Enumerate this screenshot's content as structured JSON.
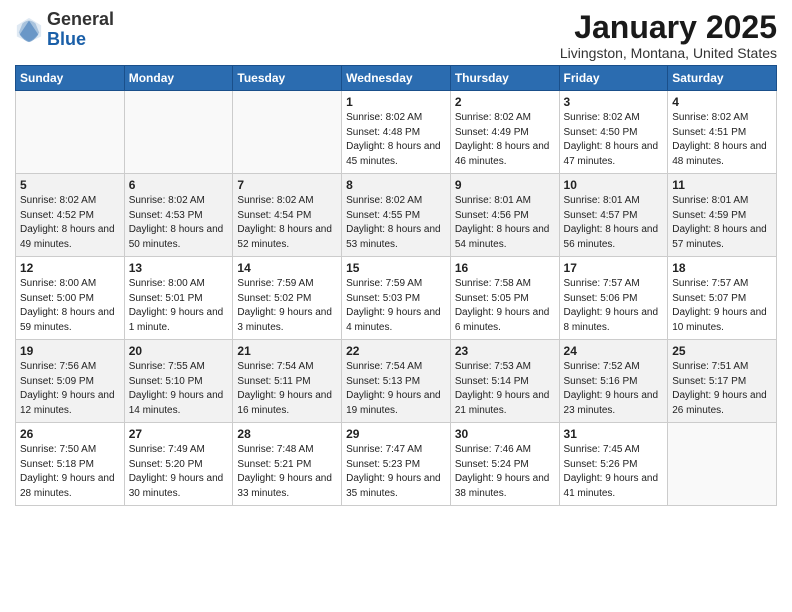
{
  "header": {
    "logo_general": "General",
    "logo_blue": "Blue",
    "month_title": "January 2025",
    "location": "Livingston, Montana, United States"
  },
  "weekdays": [
    "Sunday",
    "Monday",
    "Tuesday",
    "Wednesday",
    "Thursday",
    "Friday",
    "Saturday"
  ],
  "weeks": [
    [
      {
        "day": "",
        "info": ""
      },
      {
        "day": "",
        "info": ""
      },
      {
        "day": "",
        "info": ""
      },
      {
        "day": "1",
        "info": "Sunrise: 8:02 AM\nSunset: 4:48 PM\nDaylight: 8 hours\nand 45 minutes."
      },
      {
        "day": "2",
        "info": "Sunrise: 8:02 AM\nSunset: 4:49 PM\nDaylight: 8 hours\nand 46 minutes."
      },
      {
        "day": "3",
        "info": "Sunrise: 8:02 AM\nSunset: 4:50 PM\nDaylight: 8 hours\nand 47 minutes."
      },
      {
        "day": "4",
        "info": "Sunrise: 8:02 AM\nSunset: 4:51 PM\nDaylight: 8 hours\nand 48 minutes."
      }
    ],
    [
      {
        "day": "5",
        "info": "Sunrise: 8:02 AM\nSunset: 4:52 PM\nDaylight: 8 hours\nand 49 minutes."
      },
      {
        "day": "6",
        "info": "Sunrise: 8:02 AM\nSunset: 4:53 PM\nDaylight: 8 hours\nand 50 minutes."
      },
      {
        "day": "7",
        "info": "Sunrise: 8:02 AM\nSunset: 4:54 PM\nDaylight: 8 hours\nand 52 minutes."
      },
      {
        "day": "8",
        "info": "Sunrise: 8:02 AM\nSunset: 4:55 PM\nDaylight: 8 hours\nand 53 minutes."
      },
      {
        "day": "9",
        "info": "Sunrise: 8:01 AM\nSunset: 4:56 PM\nDaylight: 8 hours\nand 54 minutes."
      },
      {
        "day": "10",
        "info": "Sunrise: 8:01 AM\nSunset: 4:57 PM\nDaylight: 8 hours\nand 56 minutes."
      },
      {
        "day": "11",
        "info": "Sunrise: 8:01 AM\nSunset: 4:59 PM\nDaylight: 8 hours\nand 57 minutes."
      }
    ],
    [
      {
        "day": "12",
        "info": "Sunrise: 8:00 AM\nSunset: 5:00 PM\nDaylight: 8 hours\nand 59 minutes."
      },
      {
        "day": "13",
        "info": "Sunrise: 8:00 AM\nSunset: 5:01 PM\nDaylight: 9 hours\nand 1 minute."
      },
      {
        "day": "14",
        "info": "Sunrise: 7:59 AM\nSunset: 5:02 PM\nDaylight: 9 hours\nand 3 minutes."
      },
      {
        "day": "15",
        "info": "Sunrise: 7:59 AM\nSunset: 5:03 PM\nDaylight: 9 hours\nand 4 minutes."
      },
      {
        "day": "16",
        "info": "Sunrise: 7:58 AM\nSunset: 5:05 PM\nDaylight: 9 hours\nand 6 minutes."
      },
      {
        "day": "17",
        "info": "Sunrise: 7:57 AM\nSunset: 5:06 PM\nDaylight: 9 hours\nand 8 minutes."
      },
      {
        "day": "18",
        "info": "Sunrise: 7:57 AM\nSunset: 5:07 PM\nDaylight: 9 hours\nand 10 minutes."
      }
    ],
    [
      {
        "day": "19",
        "info": "Sunrise: 7:56 AM\nSunset: 5:09 PM\nDaylight: 9 hours\nand 12 minutes."
      },
      {
        "day": "20",
        "info": "Sunrise: 7:55 AM\nSunset: 5:10 PM\nDaylight: 9 hours\nand 14 minutes."
      },
      {
        "day": "21",
        "info": "Sunrise: 7:54 AM\nSunset: 5:11 PM\nDaylight: 9 hours\nand 16 minutes."
      },
      {
        "day": "22",
        "info": "Sunrise: 7:54 AM\nSunset: 5:13 PM\nDaylight: 9 hours\nand 19 minutes."
      },
      {
        "day": "23",
        "info": "Sunrise: 7:53 AM\nSunset: 5:14 PM\nDaylight: 9 hours\nand 21 minutes."
      },
      {
        "day": "24",
        "info": "Sunrise: 7:52 AM\nSunset: 5:16 PM\nDaylight: 9 hours\nand 23 minutes."
      },
      {
        "day": "25",
        "info": "Sunrise: 7:51 AM\nSunset: 5:17 PM\nDaylight: 9 hours\nand 26 minutes."
      }
    ],
    [
      {
        "day": "26",
        "info": "Sunrise: 7:50 AM\nSunset: 5:18 PM\nDaylight: 9 hours\nand 28 minutes."
      },
      {
        "day": "27",
        "info": "Sunrise: 7:49 AM\nSunset: 5:20 PM\nDaylight: 9 hours\nand 30 minutes."
      },
      {
        "day": "28",
        "info": "Sunrise: 7:48 AM\nSunset: 5:21 PM\nDaylight: 9 hours\nand 33 minutes."
      },
      {
        "day": "29",
        "info": "Sunrise: 7:47 AM\nSunset: 5:23 PM\nDaylight: 9 hours\nand 35 minutes."
      },
      {
        "day": "30",
        "info": "Sunrise: 7:46 AM\nSunset: 5:24 PM\nDaylight: 9 hours\nand 38 minutes."
      },
      {
        "day": "31",
        "info": "Sunrise: 7:45 AM\nSunset: 5:26 PM\nDaylight: 9 hours\nand 41 minutes."
      },
      {
        "day": "",
        "info": ""
      }
    ]
  ]
}
